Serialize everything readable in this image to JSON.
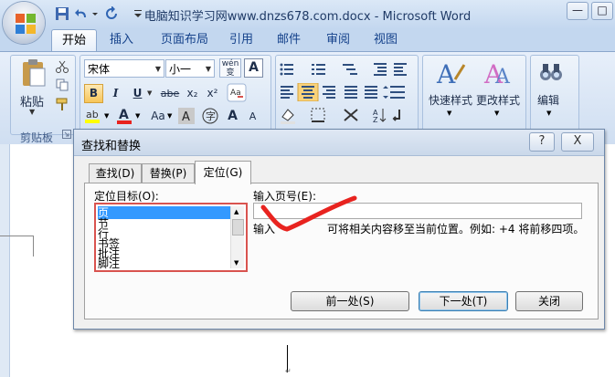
{
  "window": {
    "title": "电脑知识学习网www.dnzs678.com.docx - Microsoft Word",
    "min_glyph": "—",
    "max_glyph": "□"
  },
  "ribbon_tabs": [
    {
      "label": "开始"
    },
    {
      "label": "插入"
    },
    {
      "label": "页面布局"
    },
    {
      "label": "引用"
    },
    {
      "label": "邮件"
    },
    {
      "label": "审阅"
    },
    {
      "label": "视图"
    }
  ],
  "clipboard": {
    "paste_label": "粘贴",
    "group_label": "剪贴板"
  },
  "font": {
    "family": "宋体",
    "size": "小一",
    "wen_label": "wén 变",
    "A_label": "A",
    "bold": "B",
    "italic": "I",
    "underline": "U",
    "strike": "abe",
    "sub": "x₂",
    "sup": "x²",
    "case": "Aa",
    "grow": "A",
    "shrink": "A"
  },
  "styles": {
    "quick_label": "快速样式",
    "change_label": "更改样式"
  },
  "editing": {
    "label": "编辑"
  },
  "dialog": {
    "title": "查找和替换",
    "help_glyph": "?",
    "close_glyph": "X",
    "tabs": [
      {
        "label": "查找(D)"
      },
      {
        "label": "替换(P)"
      },
      {
        "label": "定位(G)"
      }
    ],
    "target_label": "定位目标(O):",
    "list_items": [
      {
        "label": "页"
      },
      {
        "label": "节"
      },
      {
        "label": "行"
      },
      {
        "label": "书签"
      },
      {
        "label": "批注"
      },
      {
        "label": "脚注"
      }
    ],
    "input_label": "输入页号(E):",
    "input_value": "",
    "hint_start": "输入",
    "hint_end": "可将相关内容移至当前位置。例如: +4 将前移四项。",
    "prev_button": "前一处(S)",
    "next_button": "下一处(T)",
    "close_button": "关闭"
  },
  "colors": {
    "accent": "#3399ff",
    "highlight_box": "#d9534f",
    "checkmark": "#e8231f"
  }
}
